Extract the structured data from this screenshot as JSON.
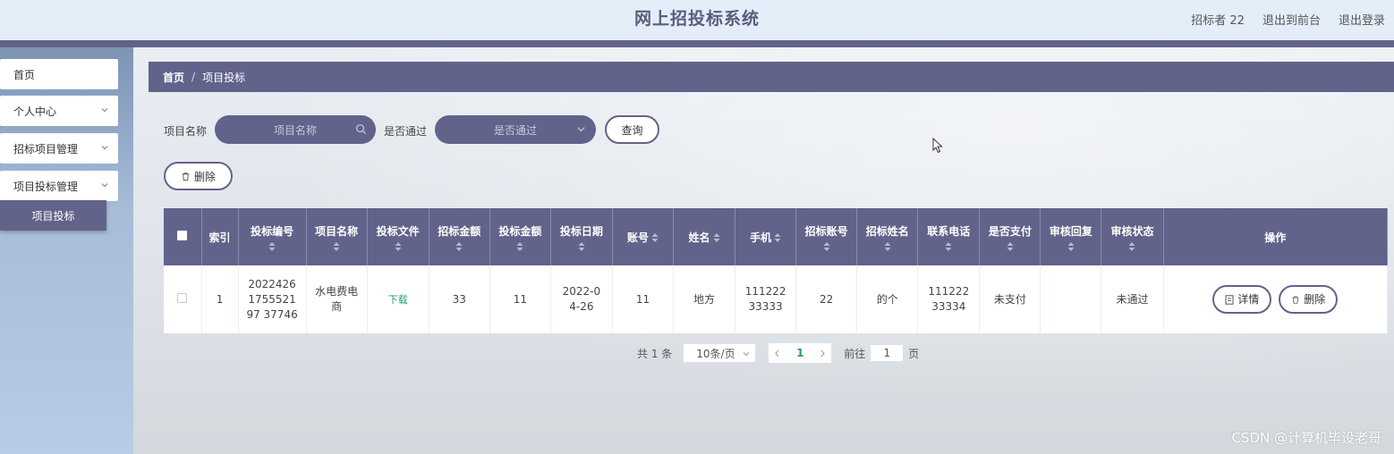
{
  "header": {
    "title": "网上招投标系统",
    "user": "招标者 22",
    "front_link": "退出到前台",
    "logout_link": "退出登录"
  },
  "sidebar": {
    "items": [
      {
        "label": "首页"
      },
      {
        "label": "个人中心"
      },
      {
        "label": "招标项目管理"
      },
      {
        "label": "项目投标管理"
      }
    ],
    "active_sub": "项目投标"
  },
  "breadcrumb": {
    "home": "首页",
    "separator": "/",
    "current": "项目投标"
  },
  "search": {
    "name_label": "项目名称",
    "name_placeholder": "项目名称",
    "pass_label": "是否通过",
    "pass_placeholder": "是否通过",
    "query_button": "查询"
  },
  "toolbar": {
    "delete_button": "删除"
  },
  "table": {
    "headers": [
      "索引",
      "投标编号",
      "项目名称",
      "投标文件",
      "招标金额",
      "投标金额",
      "投标日期",
      "账号",
      "姓名",
      "手机",
      "招标账号",
      "招标姓名",
      "联系电话",
      "是否支付",
      "审核回复",
      "审核状态",
      "操作"
    ],
    "rows": [
      {
        "index": "1",
        "bid_no": "2022426175552197 37746",
        "project_name": "水电费电商",
        "bid_file": "下载",
        "tender_amount": "33",
        "bid_amount": "11",
        "bid_date": "2022-04-26",
        "account": "11",
        "name": "地方",
        "phone": "11122233333",
        "tender_account": "22",
        "tender_name": "的个",
        "contact_phone": "11122233334",
        "paid": "未支付",
        "review_reply": "",
        "review_status": "未通过",
        "detail_button": "详情",
        "delete_button": "删除"
      }
    ]
  },
  "pagination": {
    "total": "共 1 条",
    "page_size": "10条/页",
    "current_page": "1",
    "goto_label": "前往",
    "goto_value": "1",
    "page_suffix": "页"
  },
  "watermark": "CSDN @计算机毕设老哥",
  "colors": {
    "primary": "#62638a",
    "link": "#1e9e6a"
  }
}
